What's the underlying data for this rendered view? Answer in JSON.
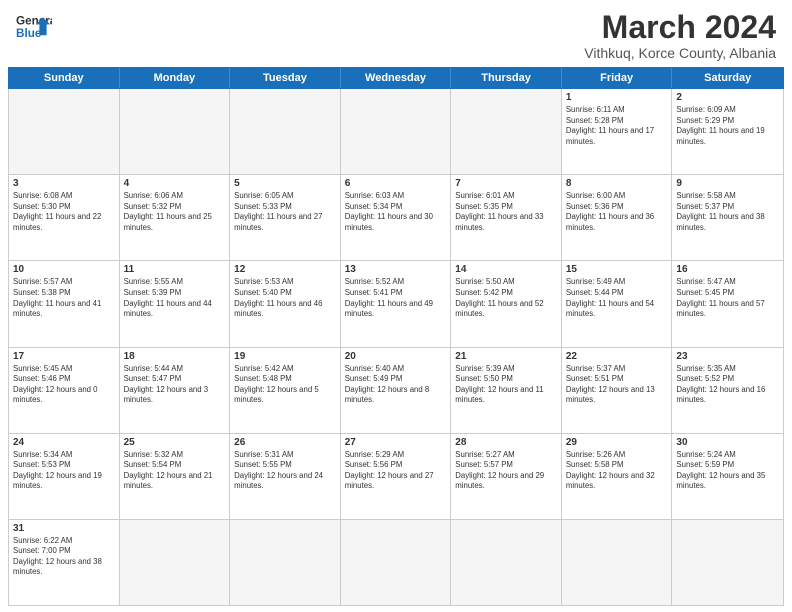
{
  "header": {
    "logo_general": "General",
    "logo_blue": "Blue",
    "month": "March 2024",
    "location": "Vithkuq, Korce County, Albania"
  },
  "days_of_week": [
    "Sunday",
    "Monday",
    "Tuesday",
    "Wednesday",
    "Thursday",
    "Friday",
    "Saturday"
  ],
  "weeks": [
    [
      {
        "day": "",
        "info": ""
      },
      {
        "day": "",
        "info": ""
      },
      {
        "day": "",
        "info": ""
      },
      {
        "day": "",
        "info": ""
      },
      {
        "day": "",
        "info": ""
      },
      {
        "day": "1",
        "info": "Sunrise: 6:11 AM\nSunset: 5:28 PM\nDaylight: 11 hours and 17 minutes."
      },
      {
        "day": "2",
        "info": "Sunrise: 6:09 AM\nSunset: 5:29 PM\nDaylight: 11 hours and 19 minutes."
      }
    ],
    [
      {
        "day": "3",
        "info": "Sunrise: 6:08 AM\nSunset: 5:30 PM\nDaylight: 11 hours and 22 minutes."
      },
      {
        "day": "4",
        "info": "Sunrise: 6:06 AM\nSunset: 5:32 PM\nDaylight: 11 hours and 25 minutes."
      },
      {
        "day": "5",
        "info": "Sunrise: 6:05 AM\nSunset: 5:33 PM\nDaylight: 11 hours and 27 minutes."
      },
      {
        "day": "6",
        "info": "Sunrise: 6:03 AM\nSunset: 5:34 PM\nDaylight: 11 hours and 30 minutes."
      },
      {
        "day": "7",
        "info": "Sunrise: 6:01 AM\nSunset: 5:35 PM\nDaylight: 11 hours and 33 minutes."
      },
      {
        "day": "8",
        "info": "Sunrise: 6:00 AM\nSunset: 5:36 PM\nDaylight: 11 hours and 36 minutes."
      },
      {
        "day": "9",
        "info": "Sunrise: 5:58 AM\nSunset: 5:37 PM\nDaylight: 11 hours and 38 minutes."
      }
    ],
    [
      {
        "day": "10",
        "info": "Sunrise: 5:57 AM\nSunset: 5:38 PM\nDaylight: 11 hours and 41 minutes."
      },
      {
        "day": "11",
        "info": "Sunrise: 5:55 AM\nSunset: 5:39 PM\nDaylight: 11 hours and 44 minutes."
      },
      {
        "day": "12",
        "info": "Sunrise: 5:53 AM\nSunset: 5:40 PM\nDaylight: 11 hours and 46 minutes."
      },
      {
        "day": "13",
        "info": "Sunrise: 5:52 AM\nSunset: 5:41 PM\nDaylight: 11 hours and 49 minutes."
      },
      {
        "day": "14",
        "info": "Sunrise: 5:50 AM\nSunset: 5:42 PM\nDaylight: 11 hours and 52 minutes."
      },
      {
        "day": "15",
        "info": "Sunrise: 5:49 AM\nSunset: 5:44 PM\nDaylight: 11 hours and 54 minutes."
      },
      {
        "day": "16",
        "info": "Sunrise: 5:47 AM\nSunset: 5:45 PM\nDaylight: 11 hours and 57 minutes."
      }
    ],
    [
      {
        "day": "17",
        "info": "Sunrise: 5:45 AM\nSunset: 5:46 PM\nDaylight: 12 hours and 0 minutes."
      },
      {
        "day": "18",
        "info": "Sunrise: 5:44 AM\nSunset: 5:47 PM\nDaylight: 12 hours and 3 minutes."
      },
      {
        "day": "19",
        "info": "Sunrise: 5:42 AM\nSunset: 5:48 PM\nDaylight: 12 hours and 5 minutes."
      },
      {
        "day": "20",
        "info": "Sunrise: 5:40 AM\nSunset: 5:49 PM\nDaylight: 12 hours and 8 minutes."
      },
      {
        "day": "21",
        "info": "Sunrise: 5:39 AM\nSunset: 5:50 PM\nDaylight: 12 hours and 11 minutes."
      },
      {
        "day": "22",
        "info": "Sunrise: 5:37 AM\nSunset: 5:51 PM\nDaylight: 12 hours and 13 minutes."
      },
      {
        "day": "23",
        "info": "Sunrise: 5:35 AM\nSunset: 5:52 PM\nDaylight: 12 hours and 16 minutes."
      }
    ],
    [
      {
        "day": "24",
        "info": "Sunrise: 5:34 AM\nSunset: 5:53 PM\nDaylight: 12 hours and 19 minutes."
      },
      {
        "day": "25",
        "info": "Sunrise: 5:32 AM\nSunset: 5:54 PM\nDaylight: 12 hours and 21 minutes."
      },
      {
        "day": "26",
        "info": "Sunrise: 5:31 AM\nSunset: 5:55 PM\nDaylight: 12 hours and 24 minutes."
      },
      {
        "day": "27",
        "info": "Sunrise: 5:29 AM\nSunset: 5:56 PM\nDaylight: 12 hours and 27 minutes."
      },
      {
        "day": "28",
        "info": "Sunrise: 5:27 AM\nSunset: 5:57 PM\nDaylight: 12 hours and 29 minutes."
      },
      {
        "day": "29",
        "info": "Sunrise: 5:26 AM\nSunset: 5:58 PM\nDaylight: 12 hours and 32 minutes."
      },
      {
        "day": "30",
        "info": "Sunrise: 5:24 AM\nSunset: 5:59 PM\nDaylight: 12 hours and 35 minutes."
      }
    ],
    [
      {
        "day": "31",
        "info": "Sunrise: 6:22 AM\nSunset: 7:00 PM\nDaylight: 12 hours and 38 minutes."
      },
      {
        "day": "",
        "info": ""
      },
      {
        "day": "",
        "info": ""
      },
      {
        "day": "",
        "info": ""
      },
      {
        "day": "",
        "info": ""
      },
      {
        "day": "",
        "info": ""
      },
      {
        "day": "",
        "info": ""
      }
    ]
  ]
}
